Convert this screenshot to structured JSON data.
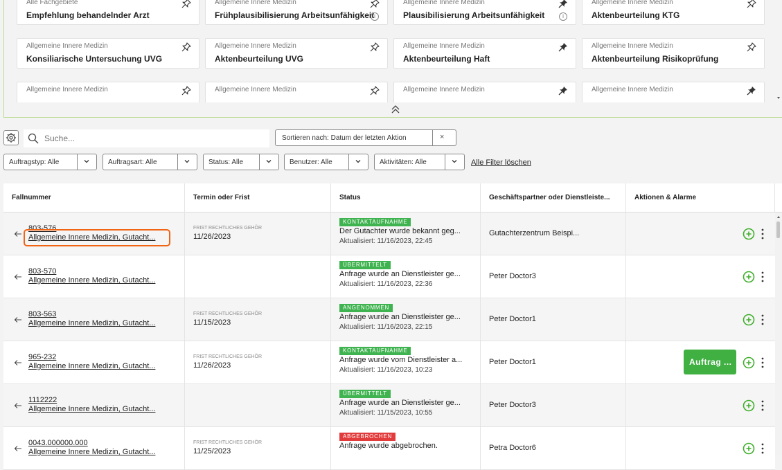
{
  "cards": [
    {
      "subtitle": "Alle Fachgebiete",
      "title": "Empfehlung behandelnder Arzt",
      "pinned": false,
      "info": false
    },
    {
      "subtitle": "Allgemeine Innere Medizin",
      "title": "Frühplausibilisierung Arbeitsunfähigkeit",
      "pinned": false,
      "info": true
    },
    {
      "subtitle": "Allgemeine Innere Medizin",
      "title": "Plausibilisierung Arbeitsunfähigkeit",
      "pinned": true,
      "info": true
    },
    {
      "subtitle": "Allgemeine Innere Medizin",
      "title": "Aktenbeurteilung KTG",
      "pinned": false,
      "info": false
    },
    {
      "subtitle": "Allgemeine Innere Medizin",
      "title": "Konsiliarische Untersuchung UVG",
      "pinned": false,
      "info": false
    },
    {
      "subtitle": "Allgemeine Innere Medizin",
      "title": "Aktenbeurteilung UVG",
      "pinned": false,
      "info": false
    },
    {
      "subtitle": "Allgemeine Innere Medizin",
      "title": "Aktenbeurteilung Haft",
      "pinned": true,
      "info": false
    },
    {
      "subtitle": "Allgemeine Innere Medizin",
      "title": "Aktenbeurteilung Risikoprüfung",
      "pinned": false,
      "info": false
    },
    {
      "subtitle": "Allgemeine Innere Medizin",
      "title": "",
      "pinned": false,
      "info": false
    },
    {
      "subtitle": "Allgemeine Innere Medizin",
      "title": "",
      "pinned": false,
      "info": false
    },
    {
      "subtitle": "Allgemeine Innere Medizin",
      "title": "",
      "pinned": true,
      "info": false
    },
    {
      "subtitle": "Allgemeine Innere Medizin",
      "title": "",
      "pinned": true,
      "info": false
    }
  ],
  "search": {
    "placeholder": "Suche..."
  },
  "sort": {
    "label": "Sortieren nach: Datum der letzten Aktion",
    "clear": "×"
  },
  "filters": [
    {
      "label": "Auftragstyp: Alle"
    },
    {
      "label": "Auftragsart: Alle"
    },
    {
      "label": "Status: Alle"
    },
    {
      "label": "Benutzer: Alle"
    },
    {
      "label": "Aktivitäten: Alle"
    }
  ],
  "clear_filters": "Alle Filter löschen",
  "columns": [
    "Fallnummer",
    "Termin oder Frist",
    "Status",
    "Geschäftspartner oder Dienstleiste...",
    "Aktionen & Alarme"
  ],
  "rows": [
    {
      "case": "803-576",
      "desc": "Allgemeine Innere Medizin, Gutacht...",
      "deadline_label": "FRIST RECHTLICHES GEHÖR",
      "deadline": "11/26/2023",
      "badge": "KONTAKTAUFNAHME",
      "badge_color": "#3fb34f",
      "status": "Der Gutachter wurde bekannt geg...",
      "updated": "Aktualisiert: 11/16/2023, 22:45",
      "partner": "Gutachterzentrum Beispi...",
      "action": ""
    },
    {
      "case": "803-570",
      "desc": "Allgemeine Innere Medizin, Gutacht...",
      "deadline_label": "",
      "deadline": "",
      "badge": "ÜBERMITTELT",
      "badge_color": "#3fb34f",
      "status": "Anfrage wurde an Dienstleister ge...",
      "updated": "Aktualisiert: 11/16/2023, 22:36",
      "partner": "Peter Doctor3",
      "action": ""
    },
    {
      "case": "803-563",
      "desc": "Allgemeine Innere Medizin, Gutacht...",
      "deadline_label": "FRIST RECHTLICHES GEHÖR",
      "deadline": "11/15/2023",
      "badge": "ANGENOMMEN",
      "badge_color": "#3fb34f",
      "status": "Anfrage wurde an Dienstleister ge...",
      "updated": "Aktualisiert: 11/16/2023, 22:15",
      "partner": "Peter Doctor1",
      "action": ""
    },
    {
      "case": "965-232",
      "desc": "Allgemeine Innere Medizin, Gutacht...",
      "deadline_label": "FRIST RECHTLICHES GEHÖR",
      "deadline": "11/26/2023",
      "badge": "KONTAKTAUFNAHME",
      "badge_color": "#3fb34f",
      "status": "Anfrage wurde vom Dienstleister a...",
      "updated": "Aktualisiert: 11/16/2023, 10:23",
      "partner": "Peter Doctor1",
      "action": "Auftrag ..."
    },
    {
      "case": "1112222",
      "desc": "Allgemeine Innere Medizin, Gutacht...",
      "deadline_label": "",
      "deadline": "",
      "badge": "ÜBERMITTELT",
      "badge_color": "#3fb34f",
      "status": "Anfrage wurde an Dienstleister ge...",
      "updated": "Aktualisiert: 11/15/2023, 10:55",
      "partner": "Peter Doctor3",
      "action": ""
    },
    {
      "case": "0043.000000.000",
      "desc": "Allgemeine Innere Medizin, Gutacht...",
      "deadline_label": "FRIST RECHTLICHES GEHÖR",
      "deadline": "11/25/2023",
      "badge": "ABGEBROCHEN",
      "badge_color": "#e23b3b",
      "status": "Anfrage wurde abgebrochen.",
      "updated": "",
      "partner": "Petra Doctor6",
      "action": ""
    }
  ]
}
